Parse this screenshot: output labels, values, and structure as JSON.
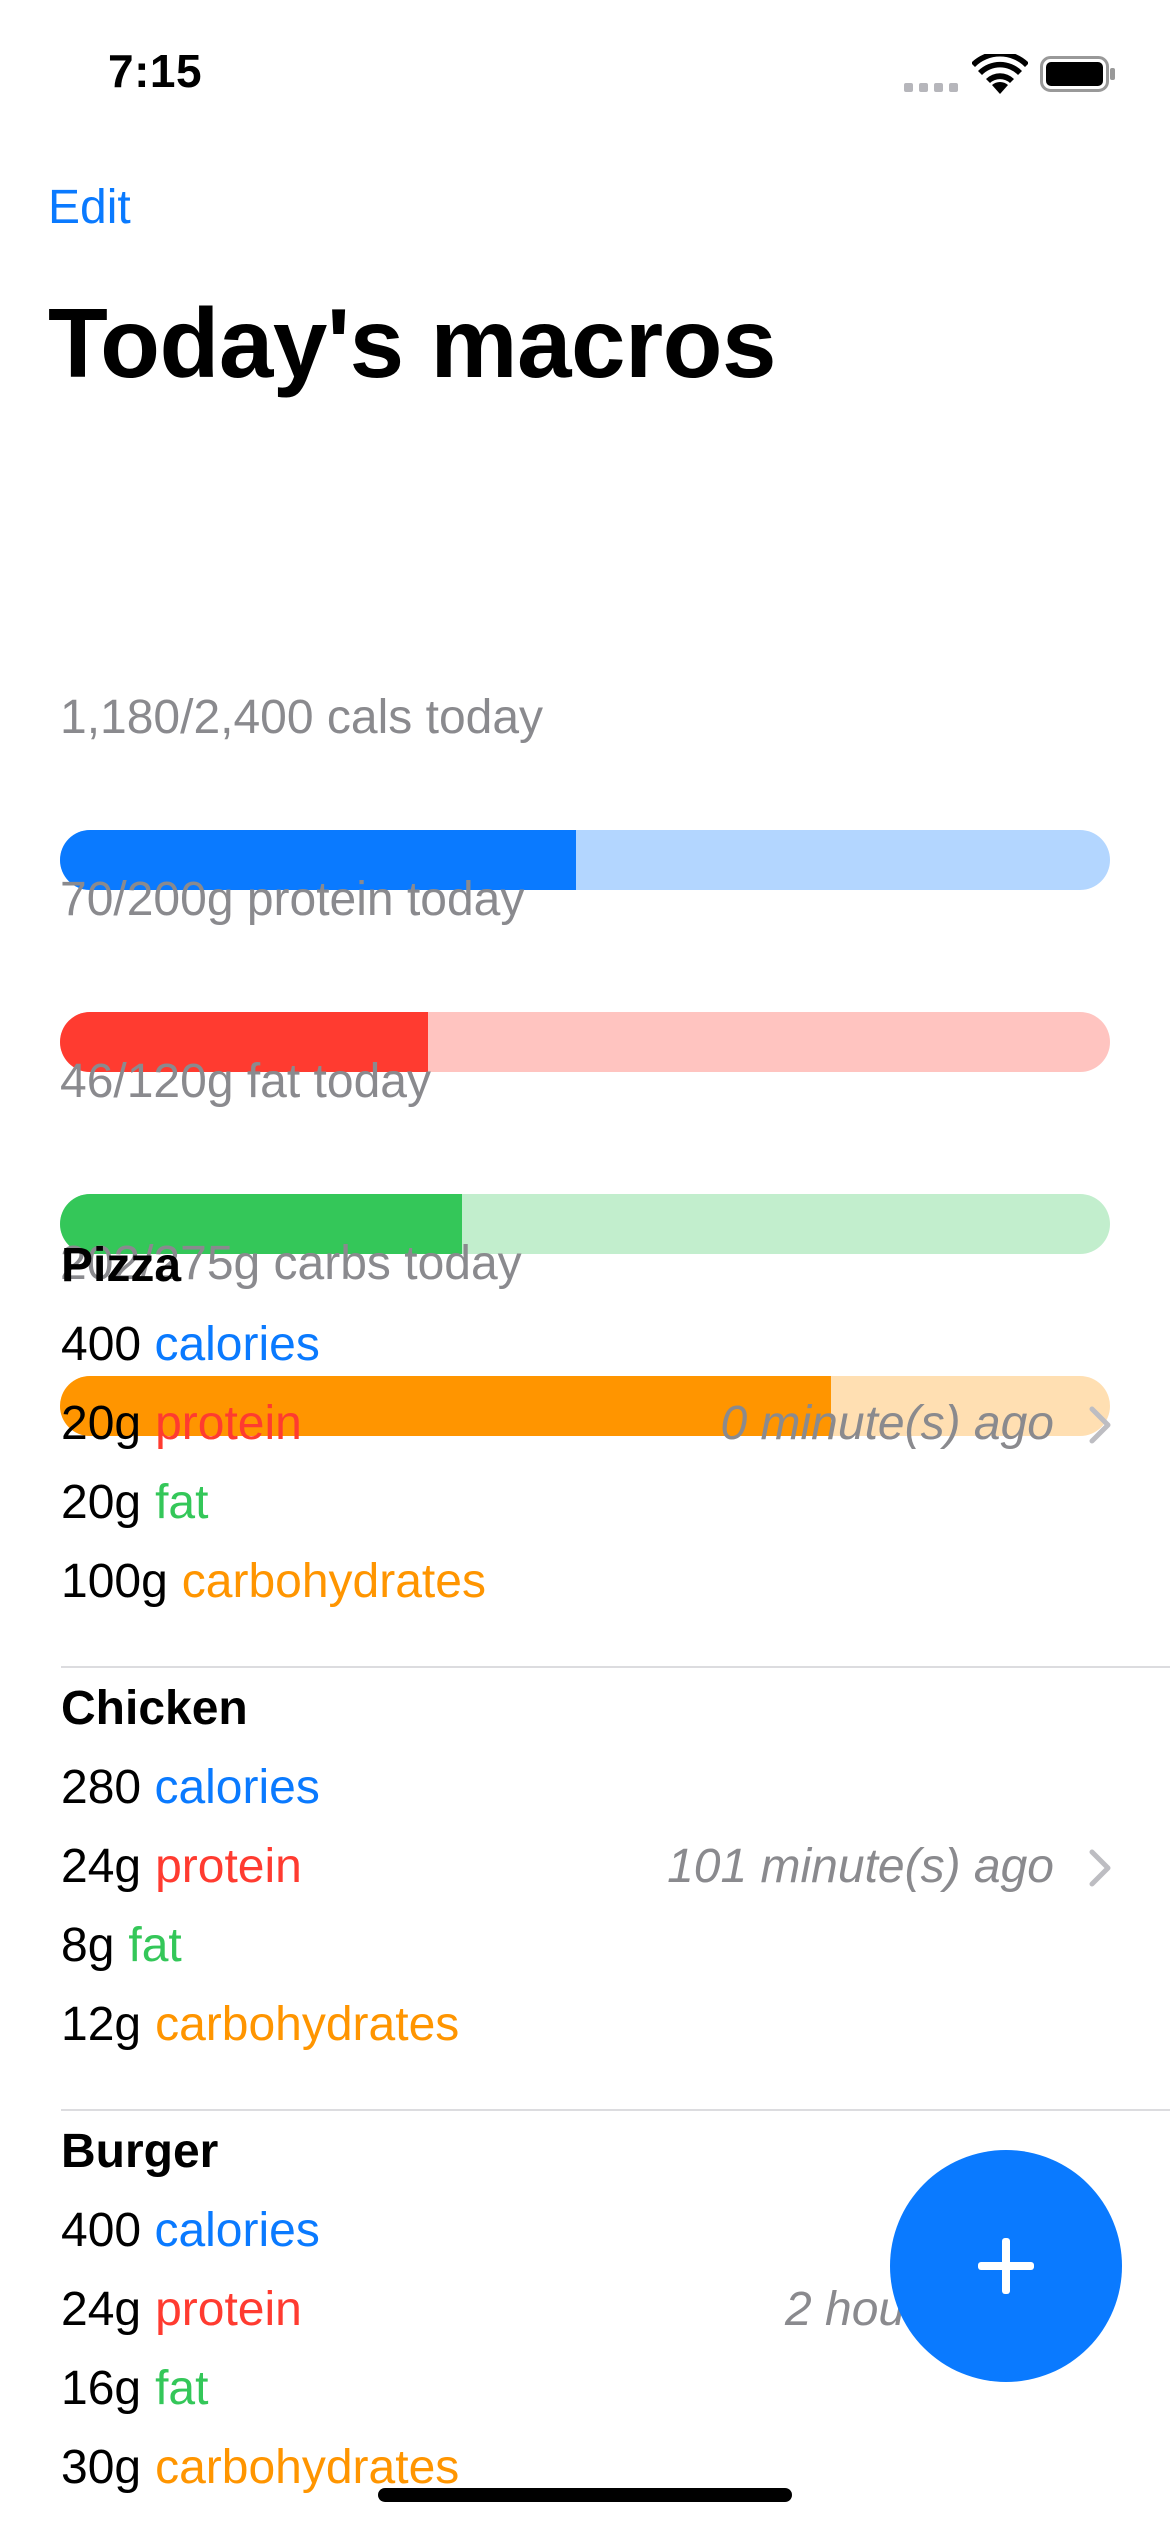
{
  "status_bar": {
    "time": "7:15"
  },
  "nav": {
    "edit_label": "Edit",
    "title": "Today's macros"
  },
  "progress": [
    {
      "label": "1,180/2,400 cals today",
      "fraction": 0.4917,
      "fill_color": "#0a7aff",
      "track_color": "#b3d6ff"
    },
    {
      "label": "70/200g protein today",
      "fraction": 0.35,
      "fill_color": "#ff3b30",
      "track_color": "#ffc4c0"
    },
    {
      "label": "46/120g fat today",
      "fraction": 0.3833,
      "fill_color": "#34c759",
      "track_color": "#c2eecd"
    },
    {
      "label": "202/275g carbs today",
      "fraction": 0.7345,
      "fill_color": "#ff9500",
      "track_color": "#ffdfb2"
    }
  ],
  "meals": [
    {
      "name": "Pizza",
      "calories_value": "400",
      "calories_label": "calories",
      "protein_value": "20g",
      "protein_label": "protein",
      "fat_value": "20g",
      "fat_label": "fat",
      "carbs_value": "100g",
      "carbs_label": "carbohydrates",
      "time_ago": "0 minute(s) ago"
    },
    {
      "name": "Chicken",
      "calories_value": "280",
      "calories_label": "calories",
      "protein_value": "24g",
      "protein_label": "protein",
      "fat_value": "8g",
      "fat_label": "fat",
      "carbs_value": "12g",
      "carbs_label": "carbohydrates",
      "time_ago": "101 minute(s) ago"
    },
    {
      "name": "Burger",
      "calories_value": "400",
      "calories_label": "calories",
      "protein_value": "24g",
      "protein_label": "protein",
      "fat_value": "16g",
      "fat_label": "fat",
      "carbs_value": "30g",
      "carbs_label": "carbohydrates",
      "time_ago": "2 hou"
    }
  ],
  "icons": {
    "cell": "cellular-signal-icon",
    "wifi": "wifi-icon",
    "battery": "battery-icon",
    "chevron": "chevron-right-icon",
    "plus": "plus-icon"
  },
  "colors": {
    "accent": "#0a7aff"
  }
}
